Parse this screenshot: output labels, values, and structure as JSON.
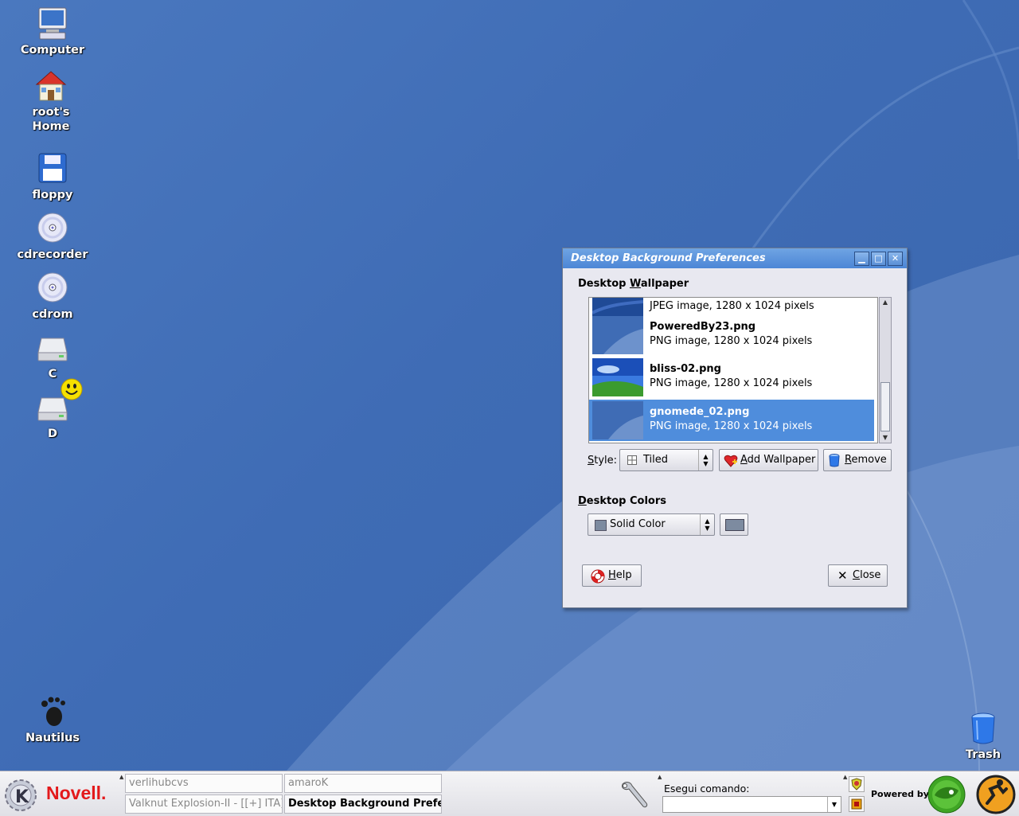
{
  "desktop": {
    "icons": [
      {
        "label": "Computer"
      },
      {
        "label": "root's Home"
      },
      {
        "label": "floppy"
      },
      {
        "label": "cdrecorder"
      },
      {
        "label": "cdrom"
      },
      {
        "label": "C"
      },
      {
        "label": "D"
      },
      {
        "label": "Nautilus"
      },
      {
        "label": "Trash"
      }
    ]
  },
  "dialog": {
    "title": "Desktop Background Preferences",
    "wallpaper_section": {
      "title_prefix": "Desktop ",
      "title_mnemonic": "W",
      "title_rest": "allpaper"
    },
    "wallpapers": [
      {
        "name": "",
        "desc": "JPEG image, 1280 x 1024 pixels"
      },
      {
        "name": "PoweredBy23.png",
        "desc": "PNG image, 1280 x 1024 pixels"
      },
      {
        "name": "bliss-02.png",
        "desc": "PNG image, 1280 x 1024 pixels"
      },
      {
        "name": "gnomede_02.png",
        "desc": "PNG image, 1280 x 1024 pixels",
        "selected": true
      }
    ],
    "style_label_mnemonic": "S",
    "style_label_rest": "tyle:",
    "style_value": "Tiled",
    "add_wallpaper": {
      "mnemonic": "A",
      "rest": "dd Wallpaper"
    },
    "remove": {
      "mnemonic": "R",
      "rest": "emove"
    },
    "colors_section": {
      "title_mnemonic": "D",
      "title_rest": "esktop Colors"
    },
    "color_mode": "Solid Color",
    "color_swatch": "#7d8ba0",
    "help": {
      "mnemonic": "H",
      "rest": "elp"
    },
    "close": {
      "mnemonic": "C",
      "rest": "lose"
    }
  },
  "taskbar": {
    "brand": "Novell.",
    "tasks": [
      {
        "label": "verlihubcvs"
      },
      {
        "label": "amaroK"
      },
      {
        "label": "Valknut Explosion-II - [[+] ITA]"
      },
      {
        "label": "Desktop Background Prefe"
      }
    ],
    "run_command_label": "Esegui comando:",
    "run_command_value": "",
    "powered_by": "Powered by"
  },
  "colors": {
    "desktop_bg": "#3f6cb5",
    "selection": "#4f8ddc",
    "titlebar": "#5a92dc"
  }
}
